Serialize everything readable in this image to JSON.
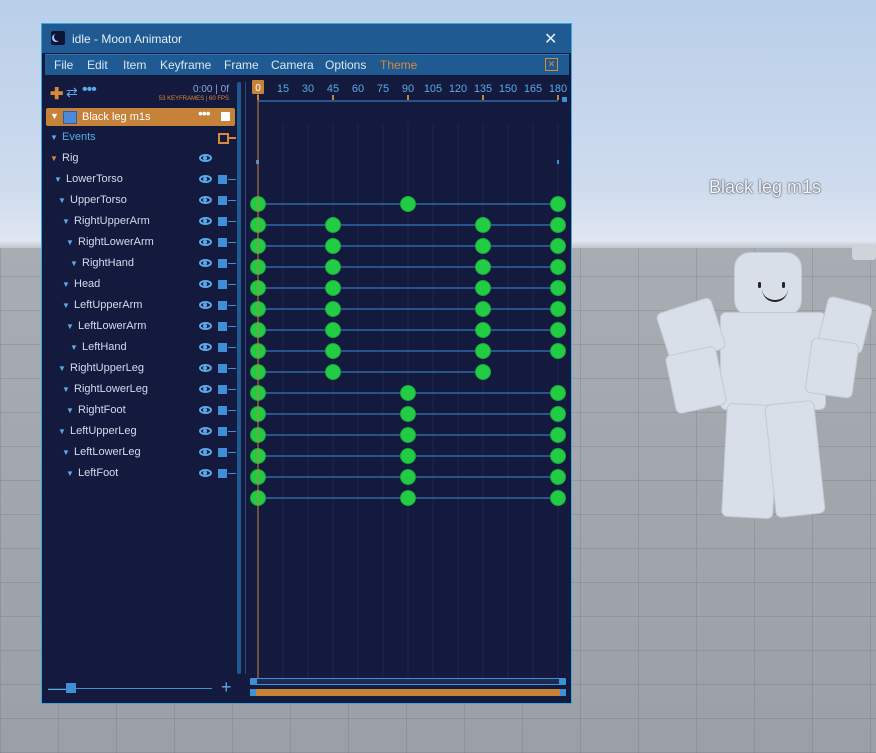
{
  "scene": {
    "character_name": "Black leg m1s"
  },
  "window": {
    "title": "idle - Moon Animator",
    "close_glyph": "✕",
    "menu": [
      "File",
      "Edit",
      "Item",
      "Keyframe",
      "Frame",
      "Camera",
      "Options",
      "Theme"
    ],
    "menu_close_glyph": "✕"
  },
  "toolbar": {
    "add_glyph": "✚",
    "loop_glyph": "⇄",
    "more_glyph": "•••",
    "time": "0:00  |  0f",
    "info": "53 KEYFRAMES  |  60 FPS"
  },
  "item": {
    "name": "Black leg m1s",
    "more_glyph": "•••",
    "expand_glyph": "▼"
  },
  "tracks": {
    "events_label": "Events",
    "rig_label": "Rig",
    "list": [
      {
        "name": "LowerTorso",
        "depth": 1
      },
      {
        "name": "UpperTorso",
        "depth": 2
      },
      {
        "name": "RightUpperArm",
        "depth": 3
      },
      {
        "name": "RightLowerArm",
        "depth": 4
      },
      {
        "name": "RightHand",
        "depth": 5
      },
      {
        "name": "Head",
        "depth": 3
      },
      {
        "name": "LeftUpperArm",
        "depth": 3
      },
      {
        "name": "LeftLowerArm",
        "depth": 4
      },
      {
        "name": "LeftHand",
        "depth": 5
      },
      {
        "name": "RightUpperLeg",
        "depth": 2
      },
      {
        "name": "RightLowerLeg",
        "depth": 3
      },
      {
        "name": "RightFoot",
        "depth": 4
      },
      {
        "name": "LeftUpperLeg",
        "depth": 2
      },
      {
        "name": "LeftLowerLeg",
        "depth": 3
      },
      {
        "name": "LeftFoot",
        "depth": 4
      }
    ]
  },
  "timeline": {
    "ticks": [
      0,
      15,
      30,
      45,
      60,
      75,
      90,
      105,
      120,
      135,
      150,
      165,
      180
    ],
    "current_frame": "0",
    "length": 180,
    "keyframes": [
      [
        0,
        90,
        180
      ],
      [
        0,
        45,
        135,
        180
      ],
      [
        0,
        45,
        135,
        180
      ],
      [
        0,
        45,
        135,
        180
      ],
      [
        0,
        45,
        135,
        180
      ],
      [
        0,
        45,
        135,
        180
      ],
      [
        0,
        45,
        135,
        180
      ],
      [
        0,
        45,
        135,
        180
      ],
      [
        0,
        45,
        135
      ],
      [
        0,
        90,
        180
      ],
      [
        0,
        90,
        180
      ],
      [
        0,
        90,
        180
      ],
      [
        0,
        90,
        180
      ],
      [
        0,
        90,
        180
      ],
      [
        0,
        90,
        180
      ]
    ]
  },
  "zoom": {
    "minus_glyph": "—",
    "plus_glyph": "+"
  },
  "colors": {
    "window_bg": "#141a3d",
    "accent_blue": "#3e8fd6",
    "accent_orange": "#c7823a",
    "keyframe_green": "#22cc44"
  }
}
